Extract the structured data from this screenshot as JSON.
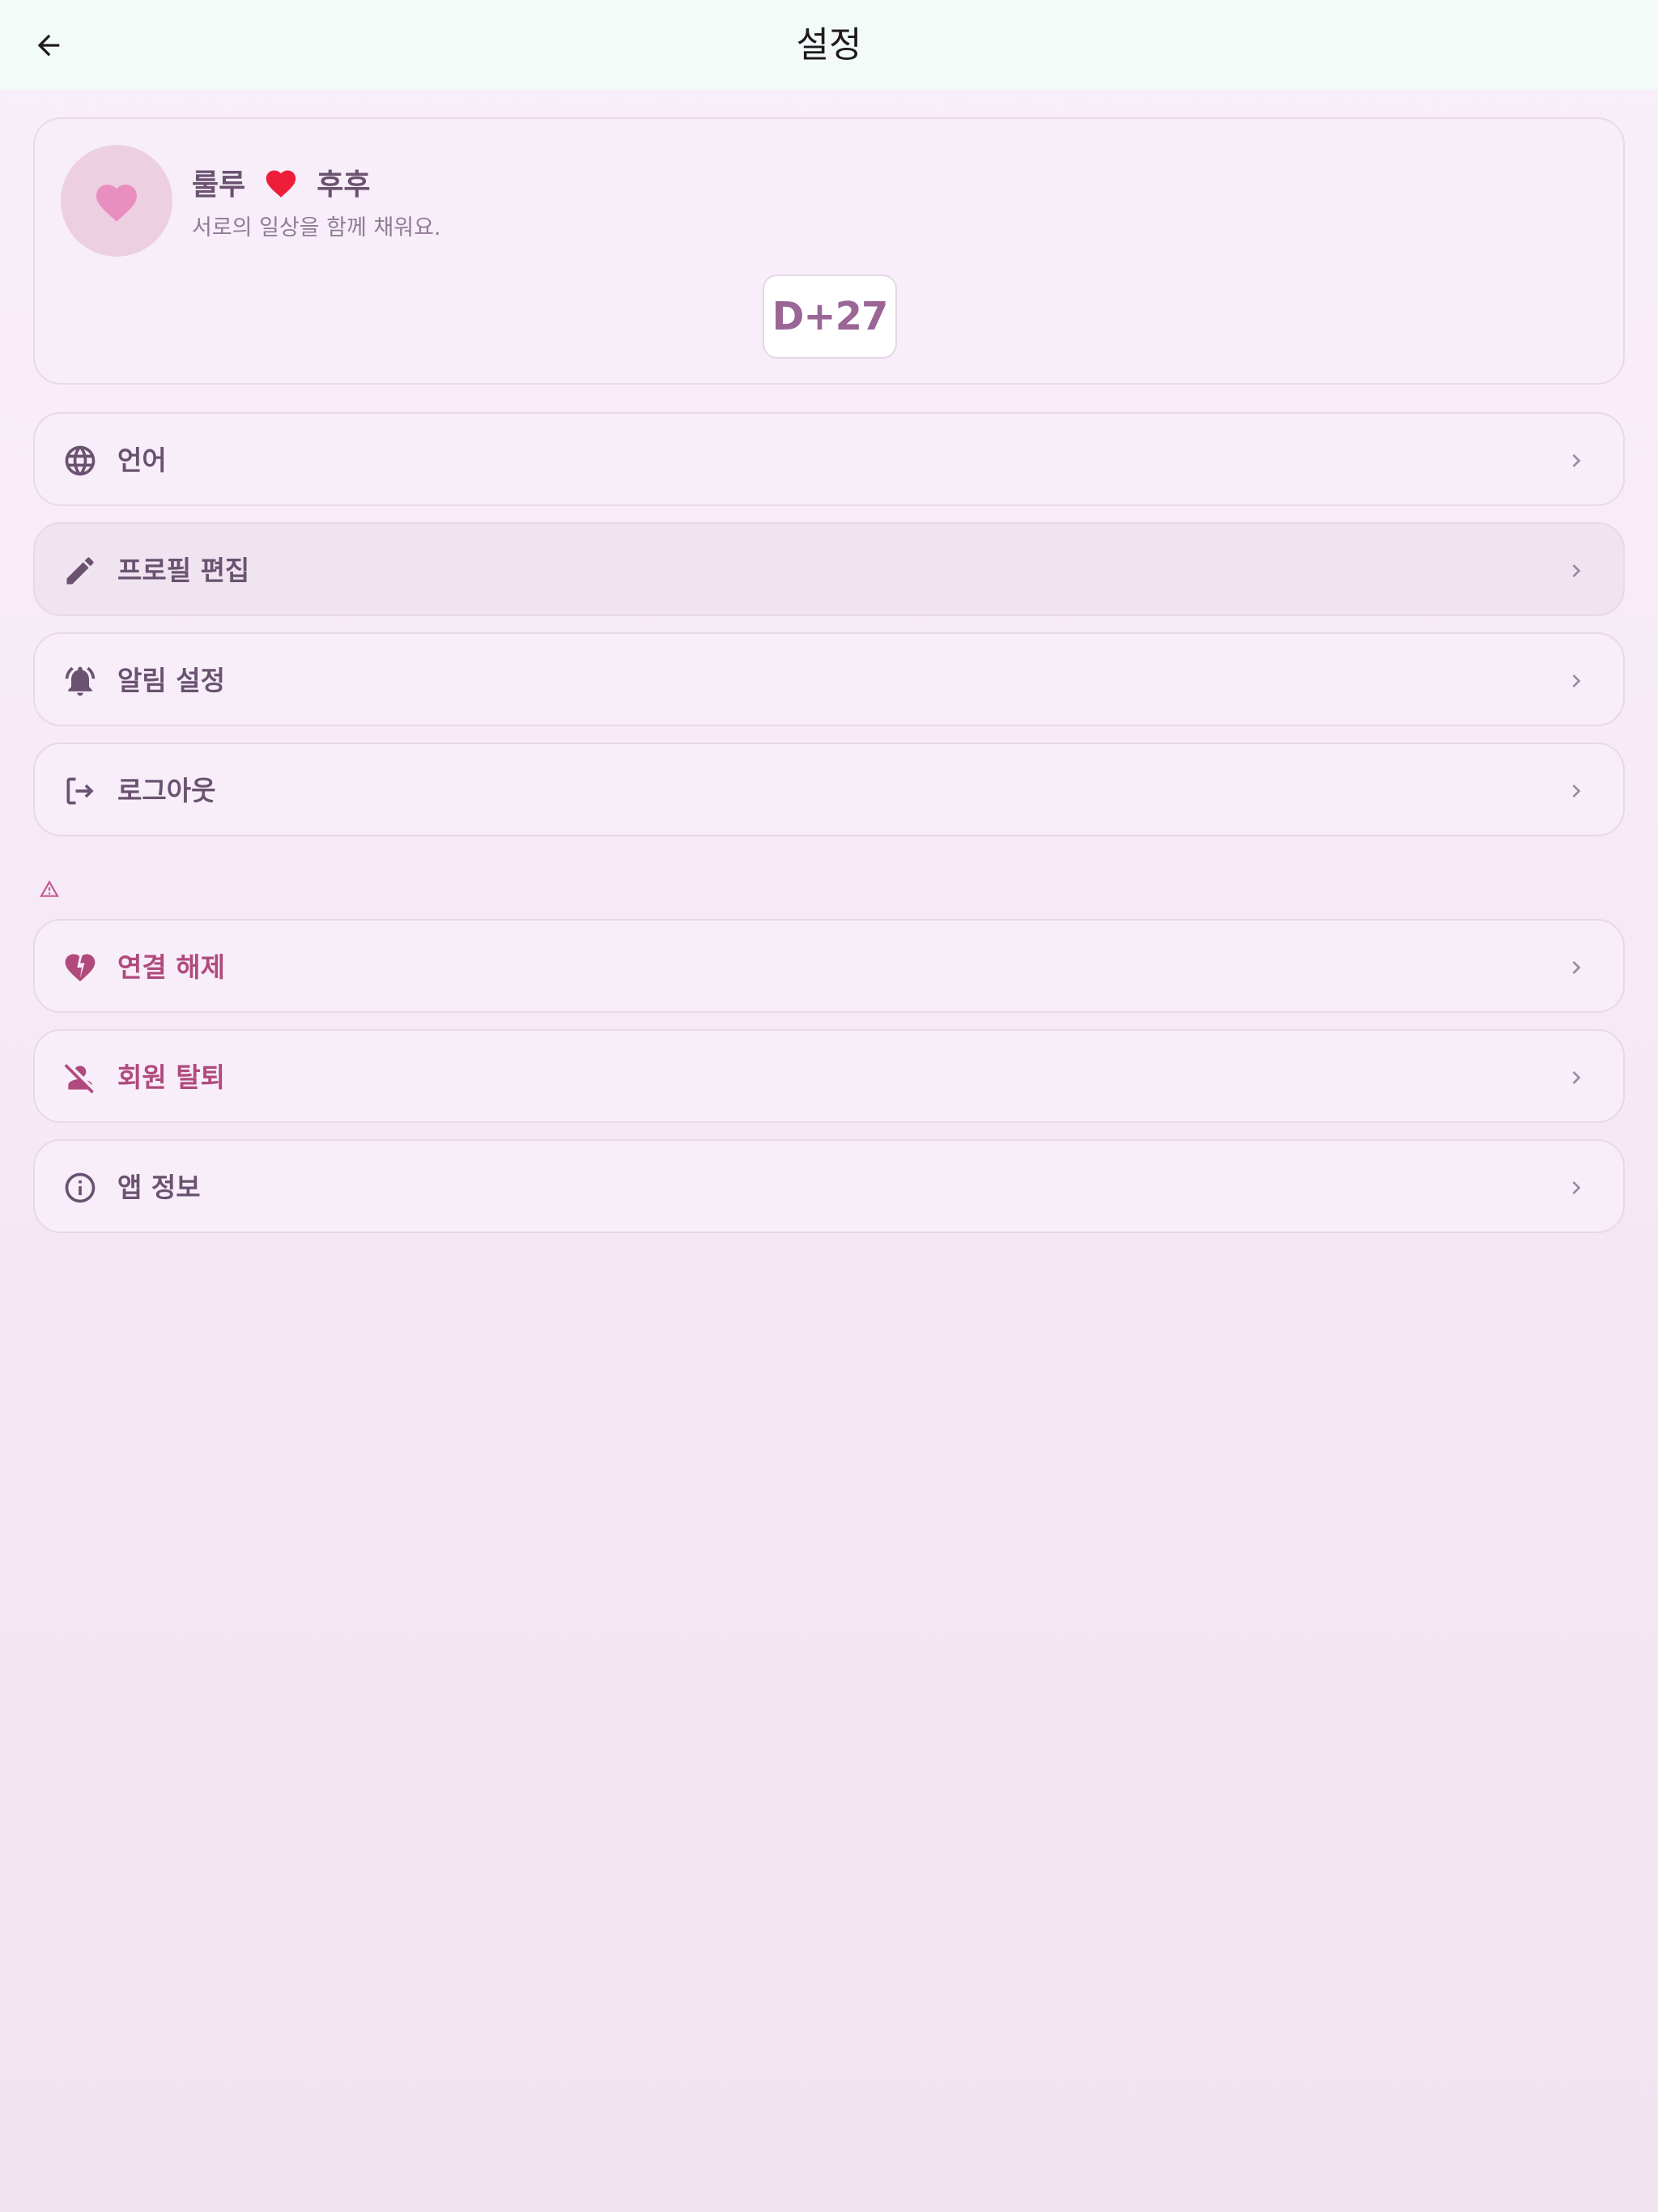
{
  "appbar": {
    "title": "설정",
    "back_icon": "arrow-left-icon"
  },
  "profile": {
    "name_left": "룰루",
    "name_right": "후후",
    "subtitle": "서로의 일상을 함께 채워요.",
    "dday": "D+27",
    "avatar_icon": "heart-icon",
    "avatar_color": "#e98ec0",
    "heart_color": "#ee1d3a"
  },
  "menu": [
    {
      "id": "language",
      "label": "언어",
      "icon": "globe-icon"
    },
    {
      "id": "edit-profile",
      "label": "프로필 편집",
      "icon": "pencil-icon"
    },
    {
      "id": "notification-settings",
      "label": "알림 설정",
      "icon": "bell-ringing-icon"
    },
    {
      "id": "logout",
      "label": "로그아웃",
      "icon": "logout-icon"
    }
  ],
  "danger_menu": [
    {
      "id": "disconnect",
      "label": "연결 해제",
      "icon": "broken-heart-icon"
    },
    {
      "id": "delete-account",
      "label": "회원 탈퇴",
      "icon": "person-off-icon"
    }
  ],
  "info_menu": [
    {
      "id": "app-info",
      "label": "앱 정보",
      "icon": "info-icon"
    }
  ],
  "colors": {
    "accent": "#6a5270",
    "danger": "#b04a7c",
    "appbar_bg": "#f3fbf8"
  }
}
